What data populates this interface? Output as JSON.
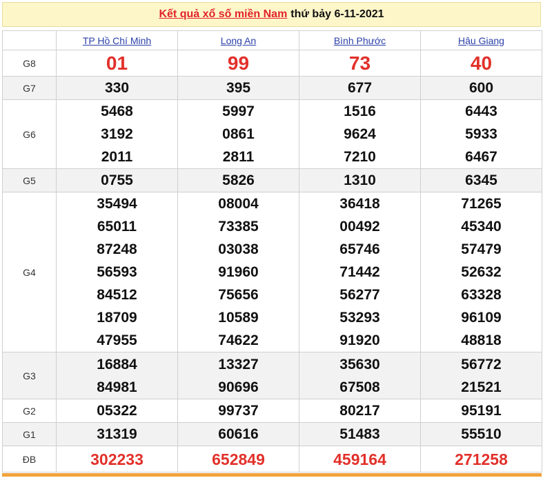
{
  "header": {
    "title_link": "Kết quả xổ số miền Nam",
    "date_text": "thứ bảy 6-11-2021"
  },
  "provinces": [
    "TP Hồ Chí Minh",
    "Long An",
    "Bình Phước",
    "Hậu Giang"
  ],
  "prizes": [
    {
      "label": "G8",
      "values": [
        [
          "01"
        ],
        [
          "99"
        ],
        [
          "73"
        ],
        [
          "40"
        ]
      ]
    },
    {
      "label": "G7",
      "values": [
        [
          "330"
        ],
        [
          "395"
        ],
        [
          "677"
        ],
        [
          "600"
        ]
      ]
    },
    {
      "label": "G6",
      "values": [
        [
          "5468",
          "3192",
          "2011"
        ],
        [
          "5997",
          "0861",
          "2811"
        ],
        [
          "1516",
          "9624",
          "7210"
        ],
        [
          "6443",
          "5933",
          "6467"
        ]
      ]
    },
    {
      "label": "G5",
      "values": [
        [
          "0755"
        ],
        [
          "5826"
        ],
        [
          "1310"
        ],
        [
          "6345"
        ]
      ]
    },
    {
      "label": "G4",
      "values": [
        [
          "35494",
          "65011",
          "87248",
          "56593",
          "84512",
          "18709",
          "47955"
        ],
        [
          "08004",
          "73385",
          "03038",
          "91960",
          "75656",
          "10589",
          "74622"
        ],
        [
          "36418",
          "00492",
          "65746",
          "71442",
          "56277",
          "53293",
          "91920"
        ],
        [
          "71265",
          "45340",
          "57479",
          "52632",
          "63328",
          "96109",
          "48818"
        ]
      ]
    },
    {
      "label": "G3",
      "values": [
        [
          "16884",
          "84981"
        ],
        [
          "13327",
          "90696"
        ],
        [
          "35630",
          "67508"
        ],
        [
          "56772",
          "21521"
        ]
      ]
    },
    {
      "label": "G2",
      "values": [
        [
          "05322"
        ],
        [
          "99737"
        ],
        [
          "80217"
        ],
        [
          "95191"
        ]
      ]
    },
    {
      "label": "G1",
      "values": [
        [
          "31319"
        ],
        [
          "60616"
        ],
        [
          "51483"
        ],
        [
          "55510"
        ]
      ]
    },
    {
      "label": "ĐB",
      "values": [
        [
          "302233"
        ],
        [
          "652849"
        ],
        [
          "459164"
        ],
        [
          "271258"
        ]
      ]
    }
  ],
  "colors": {
    "accent_red": "#e2302a",
    "link_blue": "#2a3fa8",
    "title_bg": "#fdf6c9",
    "bottom_bar": "#f2a23b"
  }
}
